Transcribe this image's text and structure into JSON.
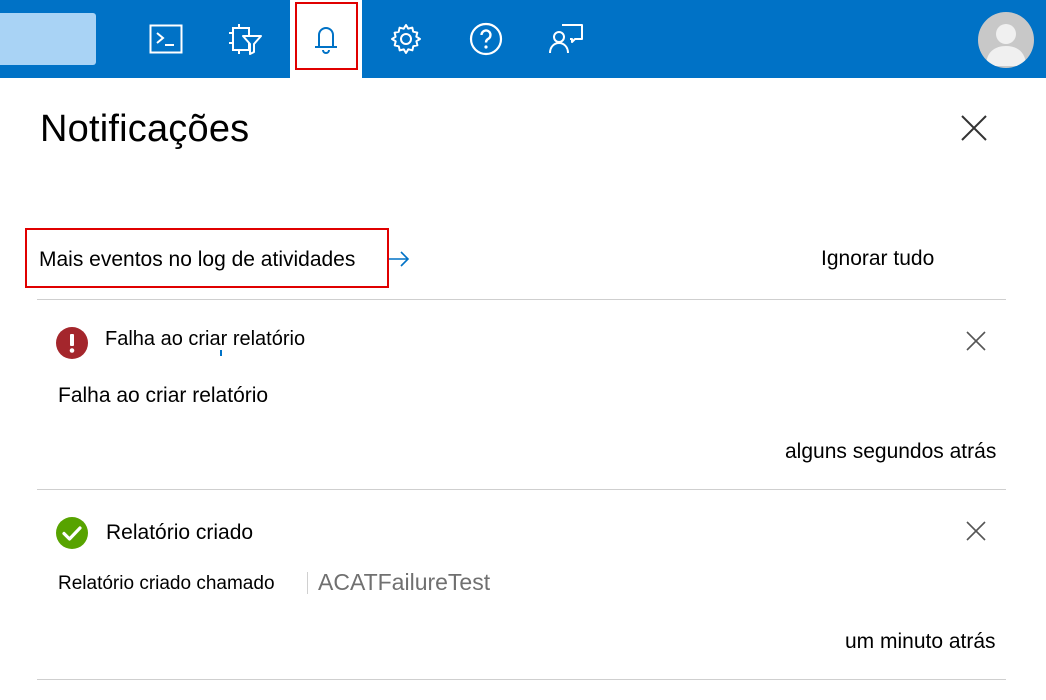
{
  "topbar": {
    "colors": {
      "bar": "#0072c6",
      "search": "#a9d3f5",
      "highlight": "#e00000"
    },
    "buttons": [
      {
        "name": "cloud-shell-icon"
      },
      {
        "name": "directory-filter-icon"
      },
      {
        "name": "notifications-bell-icon",
        "active": true
      },
      {
        "name": "settings-gear-icon"
      },
      {
        "name": "help-question-icon"
      },
      {
        "name": "feedback-icon"
      }
    ]
  },
  "panel": {
    "title": "Notificações",
    "activity_link": "Mais eventos no log de atividades",
    "dismiss_all": "Ignorar tudo"
  },
  "notifications": [
    {
      "status": "error",
      "status_icon": "exclamation-icon",
      "title": "Falha ao criar relatório",
      "body": "Falha ao criar relatório",
      "time": "alguns segundos atrás"
    },
    {
      "status": "success",
      "status_icon": "checkmark-icon",
      "title": "Relatório criado",
      "body": "Relatório criado chamado",
      "link": "ACATFailureTest",
      "time": "um minuto atrás"
    }
  ]
}
